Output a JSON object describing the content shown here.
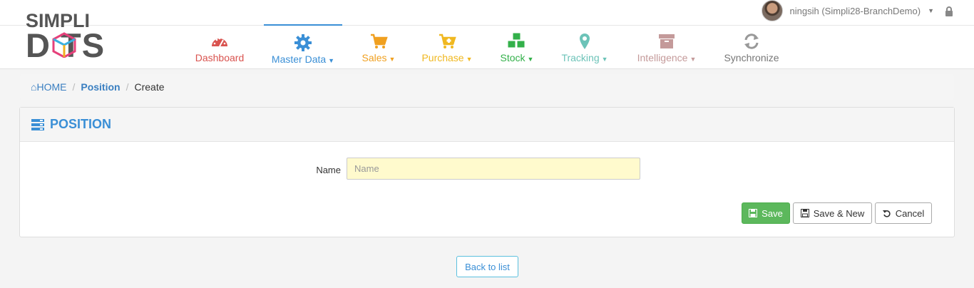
{
  "user": {
    "name": "ningsih (Simpli28-BranchDemo)"
  },
  "logo": {
    "line1": "SIMPLI",
    "line2": "D  TS"
  },
  "nav": [
    {
      "label": "Dashboard",
      "color": "#d9534f",
      "icon": "speedometer-icon",
      "caret": false
    },
    {
      "label": "Master Data",
      "color": "#3a8fd6",
      "icon": "gear-icon",
      "caret": true,
      "active": true
    },
    {
      "label": "Sales",
      "color": "#f0a020",
      "icon": "cart-icon",
      "caret": true
    },
    {
      "label": "Purchase",
      "color": "#f0b820",
      "icon": "cart-plus-icon",
      "caret": true
    },
    {
      "label": "Stock",
      "color": "#33b04a",
      "icon": "cubes-icon",
      "caret": true
    },
    {
      "label": "Tracking",
      "color": "#6cc3b8",
      "icon": "map-marker-icon",
      "caret": true
    },
    {
      "label": "Intelligence",
      "color": "#c49a9a",
      "icon": "archive-icon",
      "caret": true
    },
    {
      "label": "Synchronize",
      "color": "#777777",
      "icon": "refresh-icon",
      "caret": false
    }
  ],
  "breadcrumb": {
    "home": "HOME",
    "section": "Position",
    "current": "Create"
  },
  "panel": {
    "title": "POSITION"
  },
  "form": {
    "name_label": "Name",
    "name_placeholder": "Name",
    "name_value": ""
  },
  "buttons": {
    "save": "Save",
    "save_new": "Save & New",
    "cancel": "Cancel",
    "back": "Back to list"
  }
}
